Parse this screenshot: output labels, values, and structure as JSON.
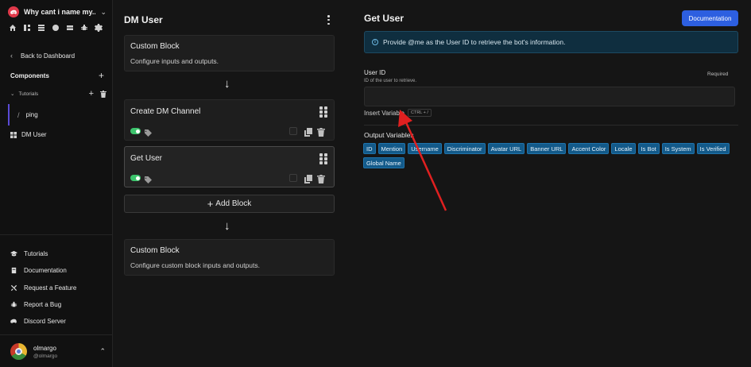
{
  "sidebar": {
    "server_name": "Why cant i name my...",
    "back_label": "Back to Dashboard",
    "components_label": "Components",
    "tutorials_folder": "Tutorials",
    "ping_label": "ping",
    "dm_user_label": "DM User",
    "footer_links": [
      "Tutorials",
      "Documentation",
      "Request a Feature",
      "Report a Bug",
      "Discord Server"
    ],
    "user": {
      "name": "olmargo",
      "handle": "@olmargo"
    }
  },
  "middle": {
    "title": "DM User",
    "blocks": [
      {
        "title": "Custom Block",
        "desc": "Configure inputs and outputs."
      },
      {
        "title": "Create DM Channel"
      },
      {
        "title": "Get User"
      },
      {
        "title": "Custom Block",
        "desc": "Configure custom block inputs and outputs."
      }
    ],
    "add_block_label": "Add Block"
  },
  "right": {
    "title": "Get User",
    "doc_button": "Documentation",
    "info_text": "Provide @me as the User ID to retrieve the bot's information.",
    "field_label": "User ID",
    "field_required": "Required",
    "field_hint": "ID of the user to retrieve.",
    "insert_variable": "Insert Variable",
    "shortcut": "CTRL + /",
    "output_label": "Output Variables",
    "outputs": [
      "ID",
      "Mention",
      "Username",
      "Discriminator",
      "Avatar URL",
      "Banner URL",
      "Accent Color",
      "Locale",
      "Is Bot",
      "Is System",
      "Is Verified",
      "Global Name"
    ]
  },
  "colors": {
    "accent": "#2d5fe0",
    "chip": "#135a8a",
    "toggle_on": "#3cc46c",
    "annotation": "#e02020"
  }
}
